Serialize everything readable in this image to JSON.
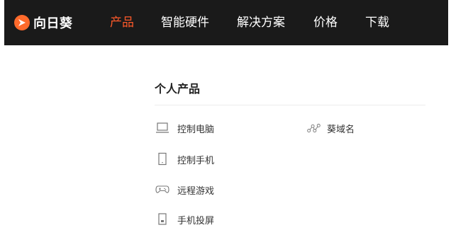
{
  "brand": {
    "name": "向日葵",
    "accent_color": "#ff5a2a"
  },
  "nav": {
    "items": [
      {
        "label": "产品",
        "active": true
      },
      {
        "label": "智能硬件",
        "active": false
      },
      {
        "label": "解决方案",
        "active": false
      },
      {
        "label": "价格",
        "active": false
      },
      {
        "label": "下载",
        "active": false
      }
    ]
  },
  "dropdown": {
    "section_title": "个人产品",
    "items": [
      {
        "label": "控制电脑",
        "icon": "laptop-icon"
      },
      {
        "label": "控制手机",
        "icon": "phone-icon"
      },
      {
        "label": "远程游戏",
        "icon": "gamepad-icon"
      },
      {
        "label": "手机投屏",
        "icon": "screen-cast-icon"
      },
      {
        "label": "葵域名",
        "icon": "network-nodes-icon"
      }
    ]
  }
}
